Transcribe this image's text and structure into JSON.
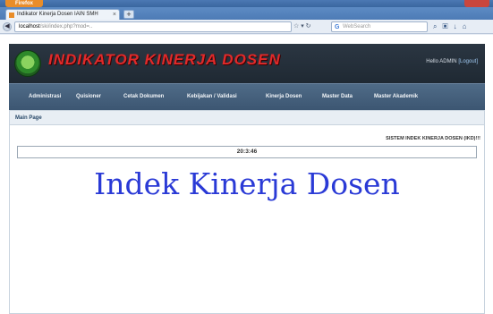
{
  "browser": {
    "menu_button": "Firefox",
    "tab_title": "Indikator Kinerja Dosen IAIN SMH",
    "url_host": "localhost",
    "url_path": "/ski/index.php?mod=..",
    "search_placeholder": "WebSearch"
  },
  "header": {
    "site_title": "INDIKATOR KINERJA DOSEN",
    "greeting": "Hello ADMIN",
    "logout": "[Logout]"
  },
  "menu": {
    "items": [
      "Administrasi",
      "Quisioner",
      "Cetak Dokumen",
      "Kebijakan / Validasi",
      "Kinerja Dosen",
      "Master Data",
      "Master Akademik"
    ]
  },
  "main": {
    "page_title": "Main Page",
    "system_label": "SISTEM INDEK KINERJA DOSEN (IKD)!!!",
    "clock": "20:3:46",
    "hero_text": "Indek Kinerja Dosen"
  }
}
